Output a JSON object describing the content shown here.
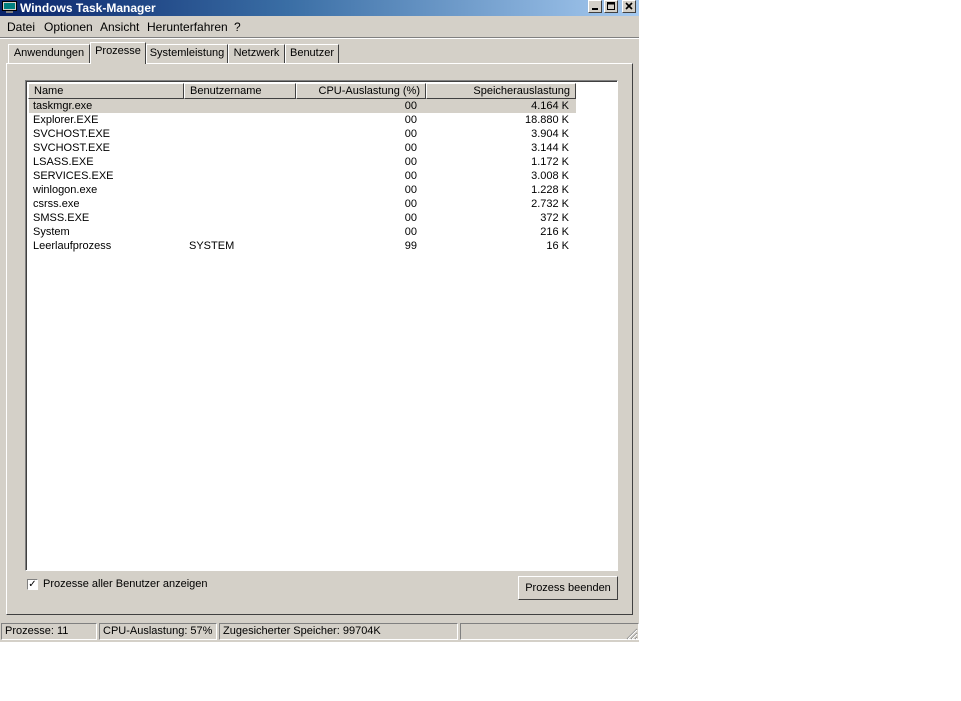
{
  "window": {
    "title": "Windows Task-Manager",
    "controls": {
      "minimize": "_",
      "maximize": "□",
      "close": "✕"
    }
  },
  "menu": [
    "Datei",
    "Optionen",
    "Ansicht",
    "Herunterfahren",
    "?"
  ],
  "tabs": [
    {
      "label": "Anwendungen",
      "active": false
    },
    {
      "label": "Prozesse",
      "active": true
    },
    {
      "label": "Systemleistung",
      "active": false
    },
    {
      "label": "Netzwerk",
      "active": false
    },
    {
      "label": "Benutzer",
      "active": false
    }
  ],
  "table": {
    "columns": [
      "Name",
      "Benutzername",
      "CPU-Auslastung (%)",
      "Speicherauslastung"
    ],
    "rows": [
      {
        "name": "taskmgr.exe",
        "user": "",
        "cpu": "00",
        "mem": "4.164 K",
        "selected": true
      },
      {
        "name": "Explorer.EXE",
        "user": "",
        "cpu": "00",
        "mem": "18.880 K"
      },
      {
        "name": "SVCHOST.EXE",
        "user": "",
        "cpu": "00",
        "mem": "3.904 K"
      },
      {
        "name": "SVCHOST.EXE",
        "user": "",
        "cpu": "00",
        "mem": "3.144 K"
      },
      {
        "name": "LSASS.EXE",
        "user": "",
        "cpu": "00",
        "mem": "1.172 K"
      },
      {
        "name": "SERVICES.EXE",
        "user": "",
        "cpu": "00",
        "mem": "3.008 K"
      },
      {
        "name": "winlogon.exe",
        "user": "",
        "cpu": "00",
        "mem": "1.228 K"
      },
      {
        "name": "csrss.exe",
        "user": "",
        "cpu": "00",
        "mem": "2.732 K"
      },
      {
        "name": "SMSS.EXE",
        "user": "",
        "cpu": "00",
        "mem": "372 K"
      },
      {
        "name": "System",
        "user": "",
        "cpu": "00",
        "mem": "216 K"
      },
      {
        "name": "Leerlaufprozess",
        "user": "SYSTEM",
        "cpu": "99",
        "mem": "16 K"
      }
    ]
  },
  "show_all_users": {
    "label": "Prozesse aller Benutzer anzeigen",
    "checked": true,
    "mark": "✓"
  },
  "end_process_button": "Prozess beenden",
  "statusbar": {
    "processes": "Prozesse: 11",
    "cpu": "CPU-Auslastung: 57%",
    "memory": "Zugesicherter Speicher: 99704K"
  },
  "colors": {
    "title_start": "#0a246a",
    "title_end": "#a6caf0",
    "face": "#d4d0c8"
  }
}
